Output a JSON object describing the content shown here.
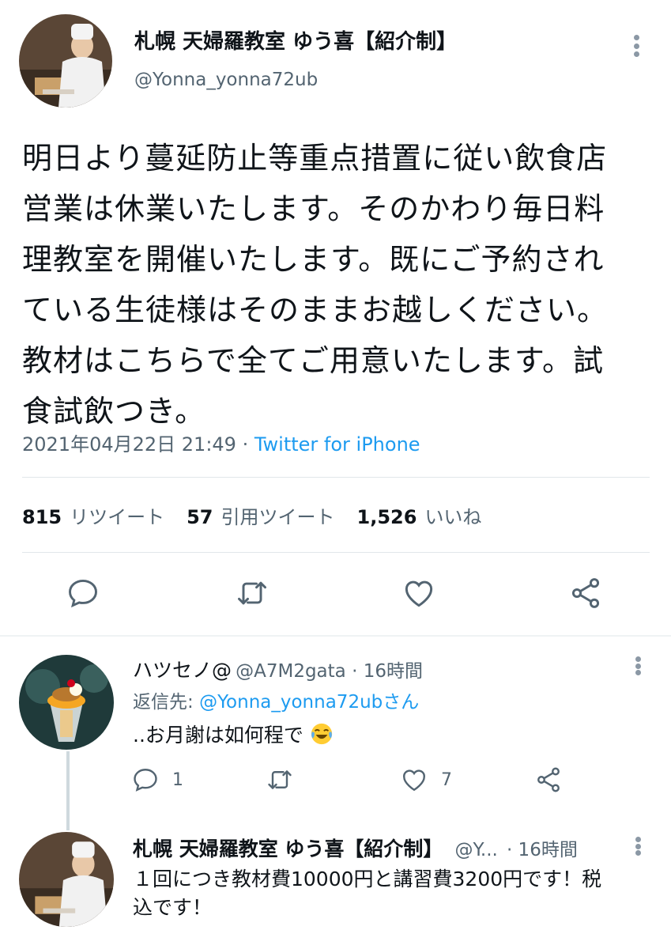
{
  "main_tweet": {
    "display_name": "札幌 天婦羅教室 ゆう喜【紹介制】",
    "handle": "@Yonna_yonna72ub",
    "text_lines": [
      "明日より蔓延防止等重点措置に従い飲食店",
      "営業は休業いたします。そのかわり毎日料",
      "理教室を開催いたします。既にご予約され",
      "ている生徒様はそのままお越しください。",
      "教材はこちらで全てご用意いたします。試",
      "食試飲つき。"
    ],
    "timestamp": "2021年04月22日 21:49",
    "separator": " · ",
    "source": "Twitter for iPhone",
    "stats": {
      "retweets_count": "815",
      "retweets_label": "リツイート",
      "quotes_count": "57",
      "quotes_label": "引用ツイート",
      "likes_count": "1,526",
      "likes_label": "いいね"
    }
  },
  "reply1": {
    "display_name": "ハツセノ@",
    "handle_time": "@A7M2gata · 16時間",
    "reply_to_prefix": "返信先: ",
    "reply_to_handle": "@Yonna_yonna72ubさん",
    "text": "..お月謝は如何程で",
    "emoji": "face-with-tears-of-joy",
    "reply_count": "1",
    "retweet_count": "",
    "like_count": "7"
  },
  "reply2": {
    "display_name": "札幌 天婦羅教室 ゆう喜【紹介制】",
    "handle": "@Y...",
    "time": "· 16時間",
    "text_lines": [
      "１回につき教材費10000円と講習費3200円です！税",
      "込です！"
    ]
  },
  "colors": {
    "text": "#0f1419",
    "secondary": "#536471",
    "link": "#1d9bf0",
    "divider": "#e1e6ea"
  },
  "icons": [
    "more-vertical-icon",
    "reply-icon",
    "retweet-icon",
    "like-icon",
    "share-icon",
    "face-with-tears-of-joy-emoji"
  ]
}
